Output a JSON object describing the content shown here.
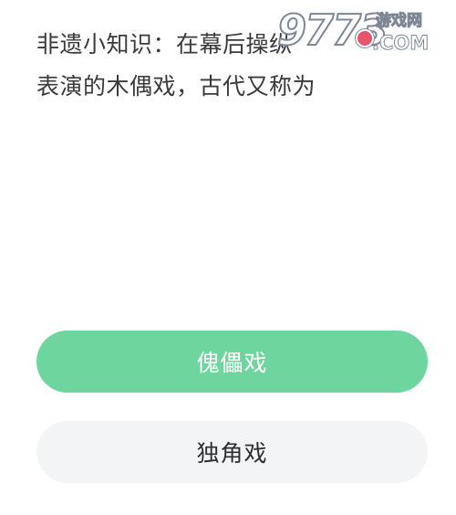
{
  "question": {
    "text": "非遗小知识：在幕后操纵\n表演的木偶戏，古代又称为"
  },
  "watermark": {
    "digits": "9773",
    "site_name": "游戏网",
    "domain": ".COM"
  },
  "options": [
    {
      "label": "傀儡戏",
      "state": "selected",
      "color": "#6ED59E"
    },
    {
      "label": "独角戏",
      "state": "default",
      "color": "#F3F4F6"
    }
  ]
}
